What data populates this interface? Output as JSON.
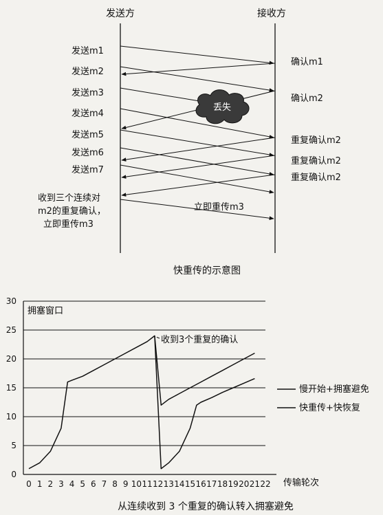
{
  "diagram1": {
    "sender_label": "发送方",
    "receiver_label": "接收方",
    "sends": [
      "发送m1",
      "发送m2",
      "发送m3",
      "发送m4",
      "发送m5",
      "发送m6",
      "发送m7"
    ],
    "acks": [
      "确认m1",
      "确认m2",
      "重复确认m2",
      "重复确认m2",
      "重复确认m2"
    ],
    "lost_label": "丢失",
    "sender_note": [
      "收到三个连续对",
      "m2的重复确认，",
      "立即重传m3"
    ],
    "retransmit_label": "立即重传m3",
    "caption": "快重传的示意图"
  },
  "chart_data": {
    "type": "line",
    "ylabel": "拥塞窗口",
    "xlabel": "传输轮次",
    "xlim": [
      0,
      22
    ],
    "ylim": [
      0,
      30
    ],
    "x_ticks": [
      0,
      1,
      2,
      3,
      4,
      5,
      6,
      7,
      8,
      9,
      10,
      11,
      12,
      13,
      14,
      15,
      16,
      17,
      18,
      19,
      20,
      21,
      22
    ],
    "y_ticks": [
      0,
      5,
      10,
      15,
      20,
      25,
      30
    ],
    "grid": "horizontal",
    "annotation": "收到3个重复的确认",
    "series": [
      {
        "name": "慢开始+拥塞避免",
        "values": [
          [
            0,
            1
          ],
          [
            1,
            2
          ],
          [
            2,
            4
          ],
          [
            3,
            8
          ],
          [
            3.6,
            16
          ],
          [
            4,
            16.3
          ],
          [
            5,
            17
          ],
          [
            6,
            18
          ],
          [
            7,
            19
          ],
          [
            8,
            20
          ],
          [
            9,
            21
          ],
          [
            10,
            22
          ],
          [
            11,
            23
          ],
          [
            11.7,
            24
          ],
          [
            12.3,
            12
          ],
          [
            13,
            13
          ],
          [
            14,
            14
          ],
          [
            15,
            15
          ],
          [
            16,
            16
          ],
          [
            17,
            17
          ],
          [
            18,
            18
          ],
          [
            19,
            19
          ],
          [
            20,
            20
          ],
          [
            21,
            21
          ]
        ]
      },
      {
        "name": "快重传+快恢复",
        "values": [
          [
            11.7,
            24
          ],
          [
            12.3,
            1
          ],
          [
            13,
            2
          ],
          [
            14,
            4
          ],
          [
            15,
            8
          ],
          [
            15.6,
            12
          ],
          [
            16,
            12.5
          ],
          [
            17,
            13.3
          ],
          [
            18,
            14.2
          ],
          [
            19,
            15
          ],
          [
            20,
            15.8
          ],
          [
            21,
            16.6
          ]
        ]
      }
    ],
    "caption": "从连续收到 3 个重复的确认转入拥塞避免"
  }
}
